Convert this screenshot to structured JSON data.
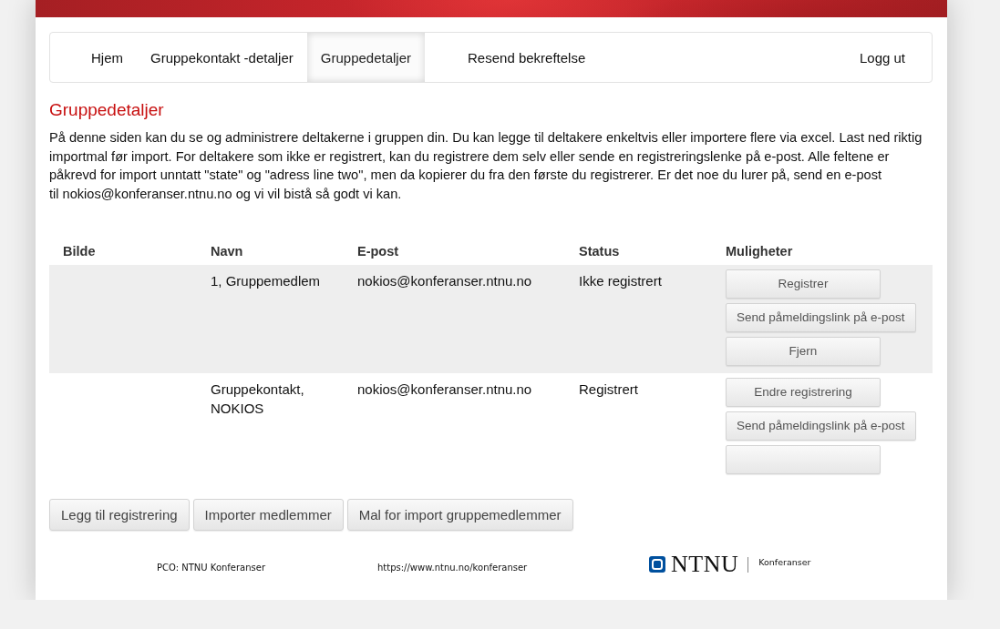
{
  "nav": {
    "tabs": [
      {
        "label": "Hjem",
        "selected": false
      },
      {
        "label": "Gruppekontakt -detaljer",
        "selected": false
      },
      {
        "label": "Gruppedetaljer",
        "selected": true
      },
      {
        "label": "Resend bekreftelse",
        "selected": false
      }
    ],
    "logout": "Logg ut"
  },
  "heading": "Gruppedetaljer",
  "intro": "På denne siden kan du se og administrere deltakerne i gruppen din. Du kan legge til deltakere enkeltvis eller importere flere via excel. Last ned riktig importmal før import. For deltakere som ikke er registrert, kan du registrere dem selv eller sende en registreringslenke på e-post. Alle feltene er påkrevd for import unntatt \"state\" og \"adress line two\", men da kopierer du fra den første du registrerer. Er det noe du lurer på, send en e-post til nokios@konferanser.ntnu.no og vi vil bistå så godt vi kan.",
  "table": {
    "columns": [
      "Bilde",
      "Navn",
      "E-post",
      "Status",
      "Muligheter"
    ],
    "rows": [
      {
        "navn": "1, Gruppemedlem",
        "epost": "nokios@konferanser.ntnu.no",
        "status": "Ikke registrert",
        "options": [
          {
            "kind": "text",
            "label": "Registrer"
          },
          {
            "kind": "text",
            "label": "Send påmeldingslink på e-post"
          },
          {
            "kind": "text",
            "label": "Fjern"
          }
        ]
      },
      {
        "navn": "Gruppekontakt, NOKIOS",
        "epost": "nokios@konferanser.ntnu.no",
        "status": "Registrert",
        "options": [
          {
            "kind": "text",
            "label": "Endre registrering"
          },
          {
            "kind": "text",
            "label": "Send påmeldingslink på e-post"
          },
          {
            "kind": "blank"
          }
        ]
      }
    ]
  },
  "actions": [
    "Legg til registrering",
    "Importer medlemmer",
    "Mal for import gruppemedlemmer"
  ],
  "footer": {
    "pco": "PCO: NTNU Konferanser",
    "url": "https://www.ntnu.no/konferanser",
    "logo": {
      "wordmark": "NTNU",
      "subtitle": "Konferanser"
    }
  }
}
